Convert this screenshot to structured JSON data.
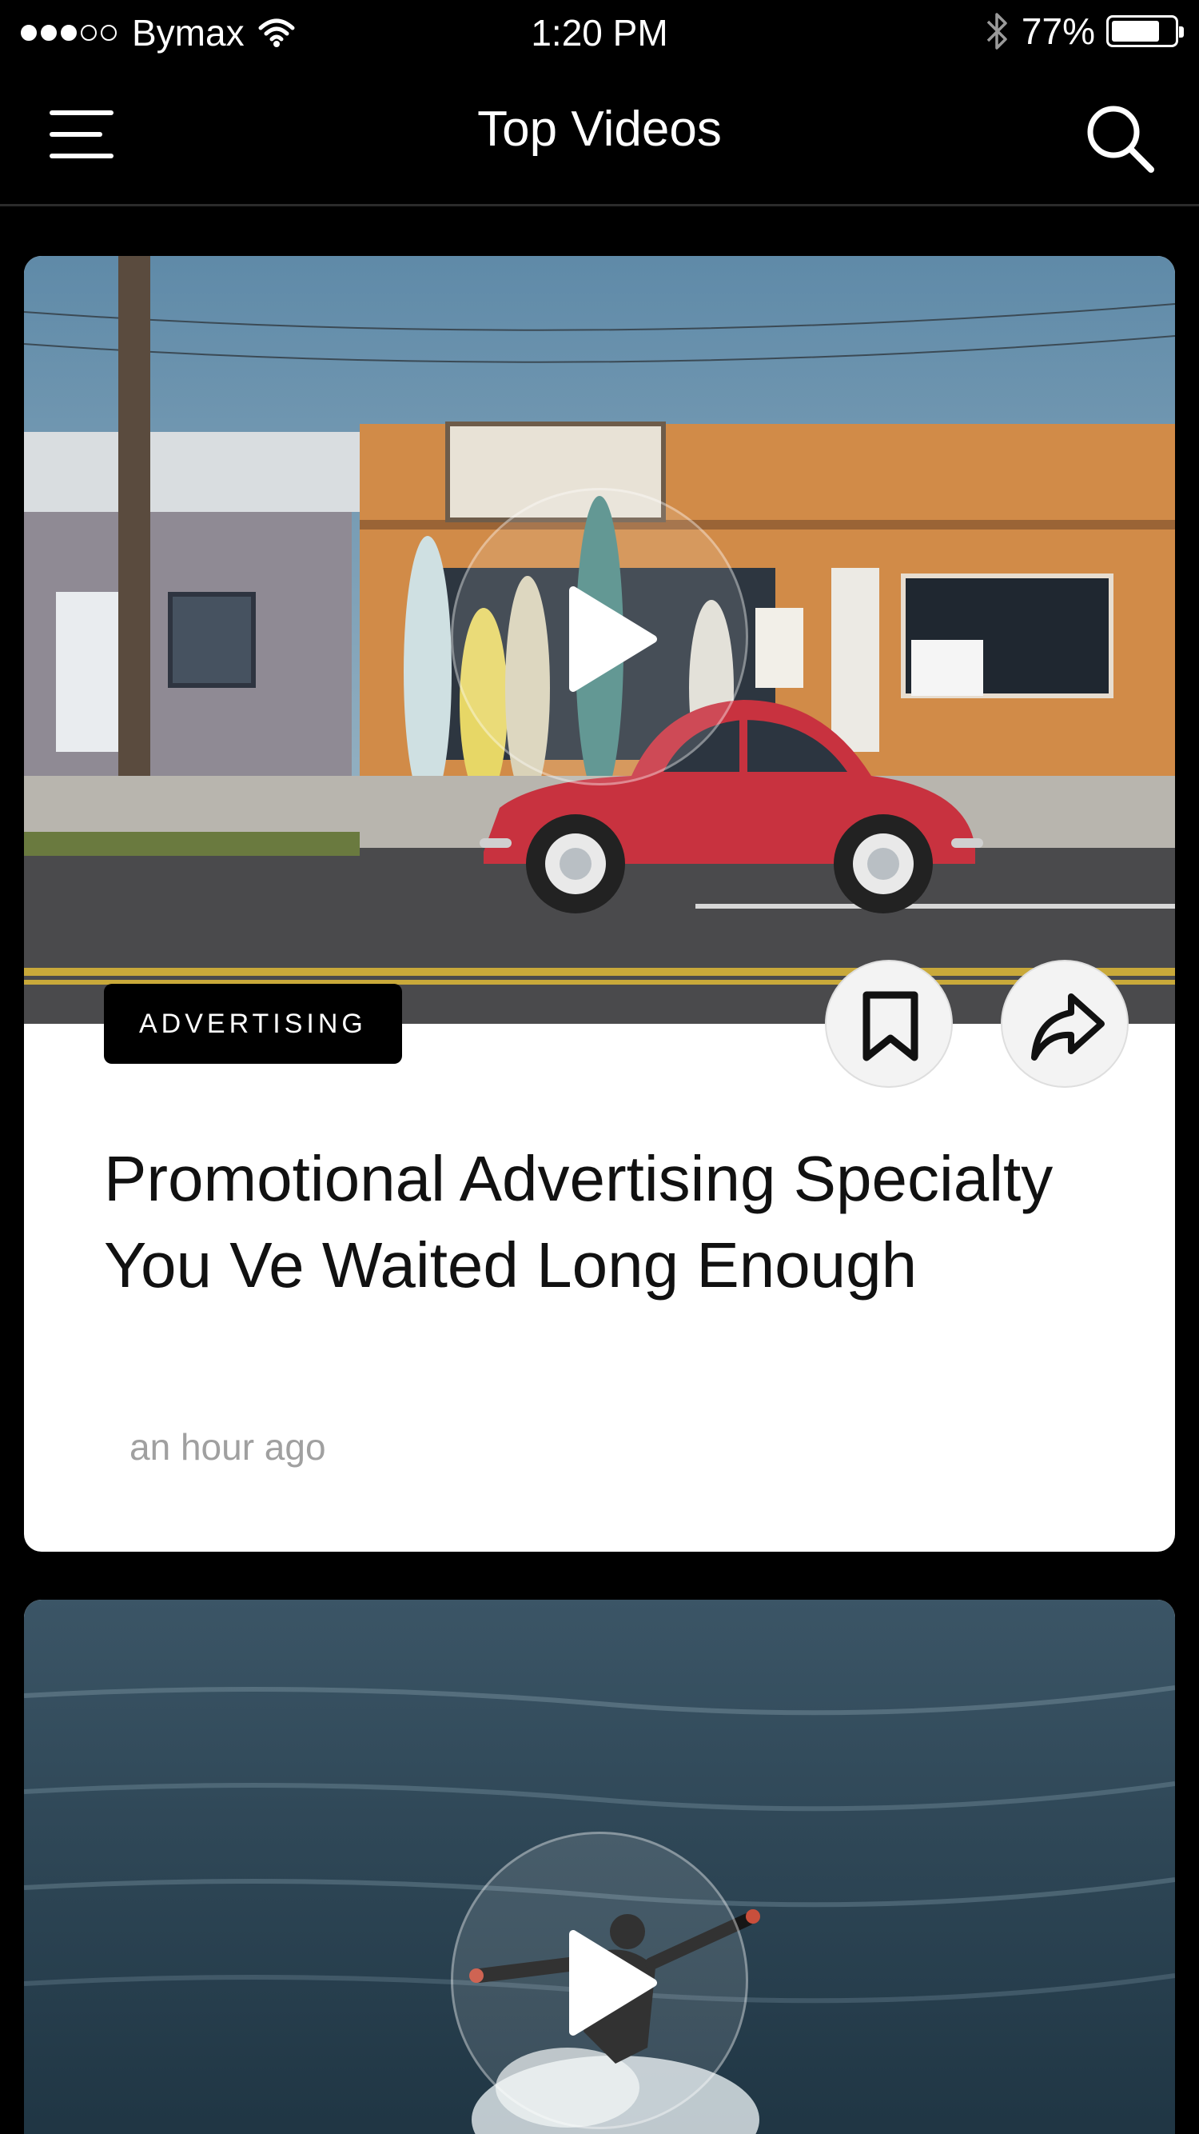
{
  "status_bar": {
    "carrier": "Bymax",
    "signal_bars_filled": 3,
    "signal_bars_total": 5,
    "time": "1:20 PM",
    "battery_percent": "77%",
    "battery_level": 0.77,
    "icons": [
      "wifi-icon",
      "bluetooth-icon",
      "battery-icon"
    ]
  },
  "nav": {
    "title": "Top Videos",
    "menu_icon": "hamburger-menu-icon",
    "search_icon": "search-icon"
  },
  "feed": {
    "cards": [
      {
        "category": "ADVERTISING",
        "title": "Promotional Advertising Specialty You Ve Waited Long Enough",
        "timestamp": "an hour ago",
        "thumbnail": "red beetle car parked in front of surf shop",
        "icons": [
          "play-icon",
          "bookmark-icon",
          "share-icon"
        ]
      },
      {
        "thumbnail": "surfer riding a wave on the ocean",
        "icons": [
          "play-icon"
        ]
      }
    ]
  },
  "colors": {
    "background": "#000000",
    "card": "#ffffff",
    "tag_background": "#000000",
    "timestamp": "#a0a0a0",
    "car_red": "#c8323f"
  }
}
